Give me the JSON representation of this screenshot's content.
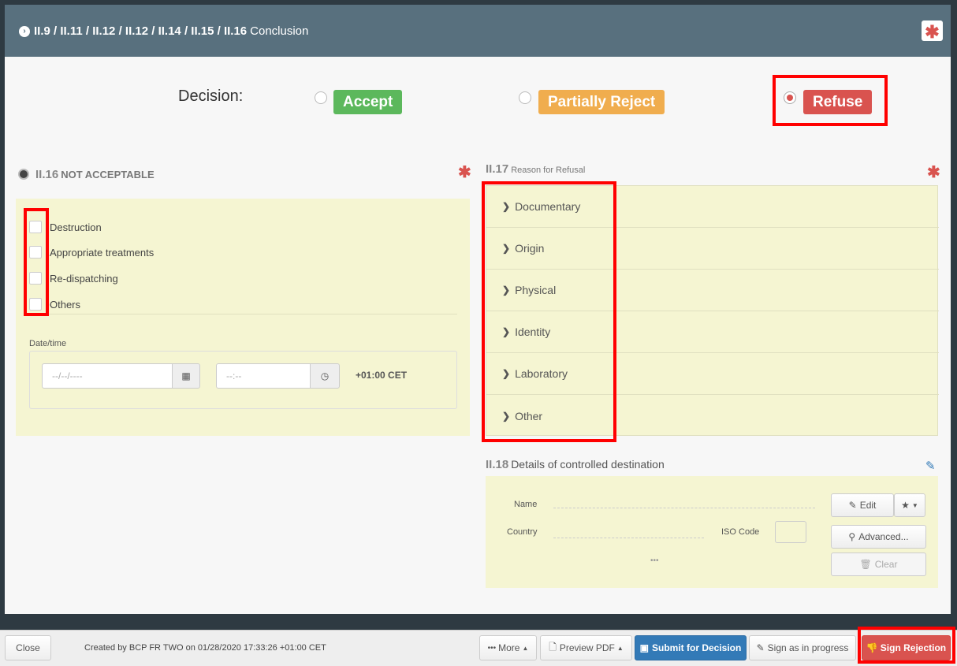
{
  "header": {
    "title_bold": "II.9 / II.11 / II.12 / II.12 / II.14 / II.15 / II.16",
    "title_rest": "Conclusion"
  },
  "decision": {
    "label": "Decision:",
    "accept": "Accept",
    "partially_reject": "Partially Reject",
    "refuse": "Refuse",
    "selected": "refuse"
  },
  "section_ii16": {
    "num": "II.16",
    "title": "NOT ACCEPTABLE",
    "options": [
      "Destruction",
      "Appropriate treatments",
      "Re-dispatching",
      "Others"
    ],
    "datetime_label": "Date/time",
    "date_placeholder": "--/--/----",
    "time_placeholder": "--:--",
    "timezone": "+01:00 CET"
  },
  "section_ii17": {
    "num": "II.17",
    "title": "Reason for Refusal",
    "items": [
      "Documentary",
      "Origin",
      "Physical",
      "Identity",
      "Laboratory",
      "Other"
    ]
  },
  "section_ii18": {
    "num": "II.18",
    "title": "Details of controlled destination",
    "name_label": "Name",
    "country_label": "Country",
    "iso_label": "ISO Code",
    "more": "•••",
    "edit": "Edit",
    "advanced": "Advanced...",
    "clear": "Clear"
  },
  "footer": {
    "close": "Close",
    "info": "Created by BCP FR TWO on 01/28/2020 17:33:26 +01:00 CET",
    "more": "More",
    "preview": "Preview PDF",
    "submit": "Submit for Decision",
    "sign_progress": "Sign as in progress",
    "sign_rejection": "Sign Rejection"
  },
  "colors": {
    "header": "#58707e",
    "accept": "#5cb85c",
    "partial": "#f0ad4e",
    "refuse": "#d9534f",
    "panel": "#f5f5d2",
    "primary": "#337ab7"
  }
}
